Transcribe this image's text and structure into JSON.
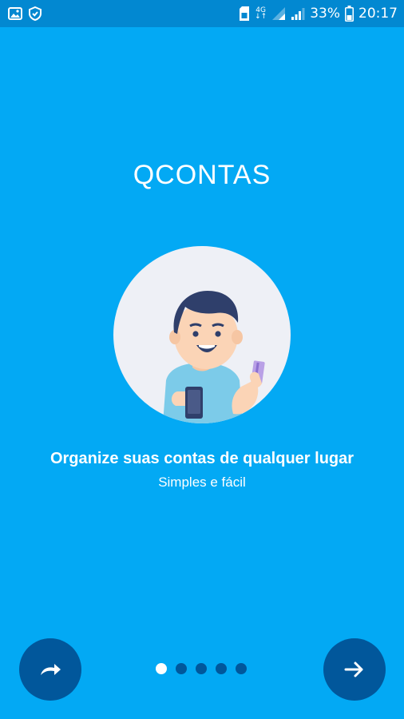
{
  "status_bar": {
    "network_type": "4G",
    "battery_percent": "33%",
    "time": "20:17",
    "icons": [
      "image-icon",
      "shield-icon",
      "sim-icon",
      "signal-icon",
      "signal-icon",
      "battery-icon"
    ]
  },
  "onboarding": {
    "app_title": "QCONTAS",
    "headline": "Organize suas contas de qualquer lugar",
    "subline": "Simples e fácil",
    "illustration": "man-holding-phone-and-card-illustration"
  },
  "navigation": {
    "skip_icon": "redo-arrow-icon",
    "next_icon": "arrow-right-icon",
    "pages_total": 5,
    "current_page": 1
  },
  "colors": {
    "background": "#03a9f4",
    "status_bar": "#0288d1",
    "button": "#01579b",
    "dot_active": "#ffffff",
    "dot_inactive": "#01579b"
  }
}
